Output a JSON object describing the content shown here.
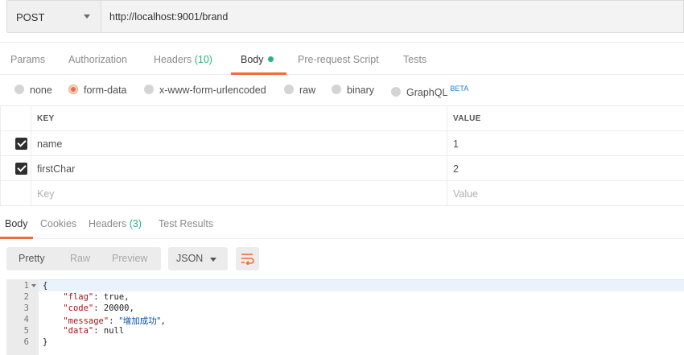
{
  "request": {
    "method": "POST",
    "url": "http://localhost:9001/brand"
  },
  "request_tabs": [
    {
      "label": "Params"
    },
    {
      "label": "Authorization"
    },
    {
      "label": "Headers",
      "count": "(10)"
    },
    {
      "label": "Body",
      "active": true
    },
    {
      "label": "Pre-request Script"
    },
    {
      "label": "Tests"
    }
  ],
  "body_types": [
    {
      "label": "none"
    },
    {
      "label": "form-data",
      "selected": true
    },
    {
      "label": "x-www-form-urlencoded"
    },
    {
      "label": "raw"
    },
    {
      "label": "binary"
    },
    {
      "label": "GraphQL",
      "badge": "BETA"
    }
  ],
  "params_table": {
    "headers": {
      "key": "KEY",
      "value": "VALUE"
    },
    "rows": [
      {
        "checked": true,
        "key": "name",
        "value": "1"
      },
      {
        "checked": true,
        "key": "firstChar",
        "value": "2"
      }
    ],
    "placeholder": {
      "key": "Key",
      "value": "Value"
    }
  },
  "response_tabs": [
    {
      "label": "Body",
      "active": true
    },
    {
      "label": "Cookies"
    },
    {
      "label": "Headers",
      "count": "(3)"
    },
    {
      "label": "Test Results"
    }
  ],
  "response_toolbar": {
    "view_modes": [
      "Pretty",
      "Raw",
      "Preview"
    ],
    "active_view": "Pretty",
    "format": "JSON"
  },
  "response_code": {
    "line_numbers": [
      "1",
      "2",
      "3",
      "4",
      "5",
      "6"
    ],
    "open_brace": "{",
    "close_brace": "}",
    "fields": [
      {
        "key": "\"flag\"",
        "value": "true",
        "kind": "literal"
      },
      {
        "key": "\"code\"",
        "value": "20000",
        "kind": "literal"
      },
      {
        "key": "\"message\"",
        "value": "\"增加成功\"",
        "kind": "string"
      },
      {
        "key": "\"data\"",
        "value": "null",
        "kind": "literal"
      }
    ]
  },
  "colors": {
    "accent": "#f26b3a",
    "count_green": "#26b47f",
    "beta_blue": "#2a7ed0"
  }
}
